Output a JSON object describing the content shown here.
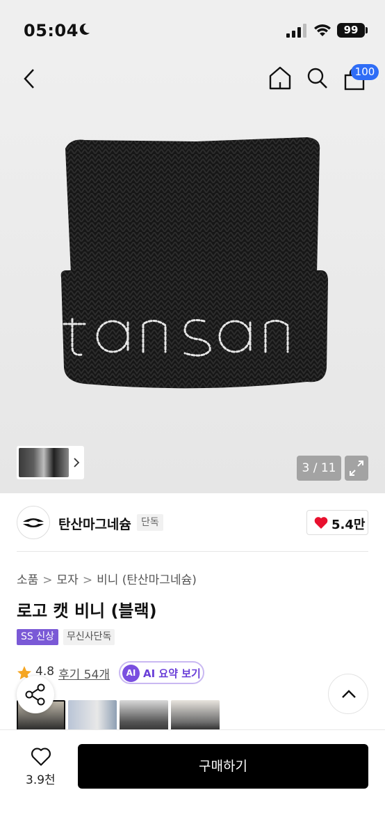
{
  "status_bar": {
    "time": "05:04",
    "battery": "99"
  },
  "header": {
    "cart_count": "100"
  },
  "hero": {
    "page_counter": "3 / 11"
  },
  "brand": {
    "name": "탄산마그네슘",
    "tag": "단독",
    "likes": "5.4만"
  },
  "breadcrumb": [
    "소품",
    "모자",
    "비니 (탄산마그네슘)"
  ],
  "product": {
    "title": "로고 캣 비니 (블랙)",
    "tags": [
      "SS 신상",
      "무신사단독"
    ],
    "rating": "4.8",
    "reviews": "후기 54개",
    "ai_badge": "AI",
    "ai_label": "AI 요약 보기"
  },
  "bottom": {
    "wish_count": "3.9천",
    "buy_label": "구매하기"
  },
  "colors": {
    "accent_purple": "#7a59d6",
    "badge_blue": "#2f6df6",
    "heart_red": "#e8102e",
    "star_orange": "#f5a623"
  },
  "icons": [
    "moon-icon",
    "signal-icon",
    "wifi-icon",
    "back-icon",
    "home-icon",
    "search-icon",
    "cart-icon",
    "chevron-right-icon",
    "expand-icon",
    "heart-icon",
    "star-icon",
    "share-icon",
    "chevron-up-icon"
  ]
}
